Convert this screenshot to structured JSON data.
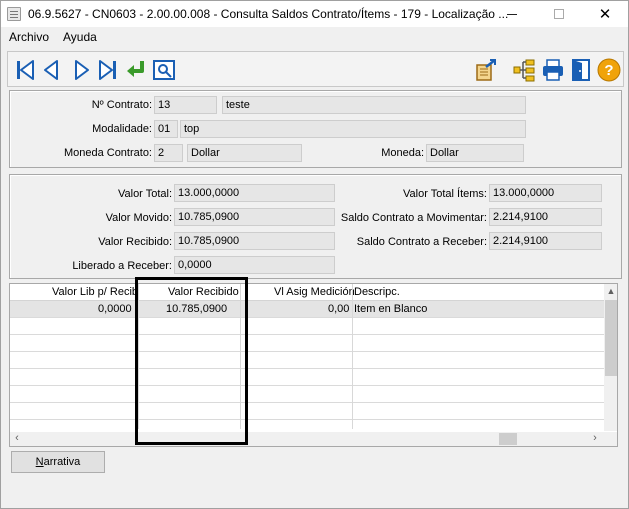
{
  "window": {
    "title": "06.9.5627 - CN0603 - 2.00.00.008 - Consulta Saldos Contrato/Ítems - 179 - Localização ...",
    "controls": {
      "minimize": "—",
      "maximize": "☐",
      "close": "✕"
    }
  },
  "menu": {
    "items": [
      "Archivo",
      "Ayuda"
    ]
  },
  "toolbar": {
    "icons": [
      "first-record-icon",
      "previous-record-icon",
      "next-record-icon",
      "last-record-icon",
      "goto-icon",
      "search-icon",
      "export-icon",
      "hierarchy-icon",
      "print-icon",
      "exit-icon",
      "help-icon"
    ]
  },
  "header_panel": {
    "contract_label": "Nº Contrato:",
    "contract_number": "13",
    "contract_desc": "teste",
    "modality_label": "Modalidade:",
    "modality_code": "01",
    "modality_desc": "top",
    "contract_currency_label": "Moneda Contrato:",
    "contract_currency_code": "2",
    "contract_currency_desc": "Dollar",
    "currency_label": "Moneda:",
    "currency_value": "Dollar"
  },
  "values_panel": {
    "valor_total_label": "Valor Total:",
    "valor_total": "13.000,0000",
    "valor_movido_label": "Valor Movido:",
    "valor_movido": "10.785,0900",
    "valor_recibido_label": "Valor Recibido:",
    "valor_recibido": "10.785,0900",
    "liberado_label": "Liberado a Receber:",
    "liberado": "0,0000",
    "valor_total_items_label": "Valor Total Ítems:",
    "valor_total_items": "13.000,0000",
    "saldo_movimentar_label": "Saldo Contrato a Movimentar:",
    "saldo_movimentar": "2.214,9100",
    "saldo_receber_label": "Saldo Contrato a Receber:",
    "saldo_receber": "2.214,9100"
  },
  "grid": {
    "columns": [
      "Valor Lib p/ Recib",
      "Valor Recibido",
      "Vl Asig Medición",
      "Descripc."
    ],
    "rows": [
      {
        "valor_lib": "0,0000",
        "valor_recibido": "10.785,0900",
        "vl_asig": "0,00",
        "descripc": "Item en Blanco"
      }
    ]
  },
  "buttons": {
    "narrativa_prefix": "N",
    "narrativa_rest": "arrativa"
  },
  "colors": {
    "accent_blue": "#1a5fb4",
    "help_orange": "#f0a30a",
    "selected_row": "#e4e4e4"
  }
}
